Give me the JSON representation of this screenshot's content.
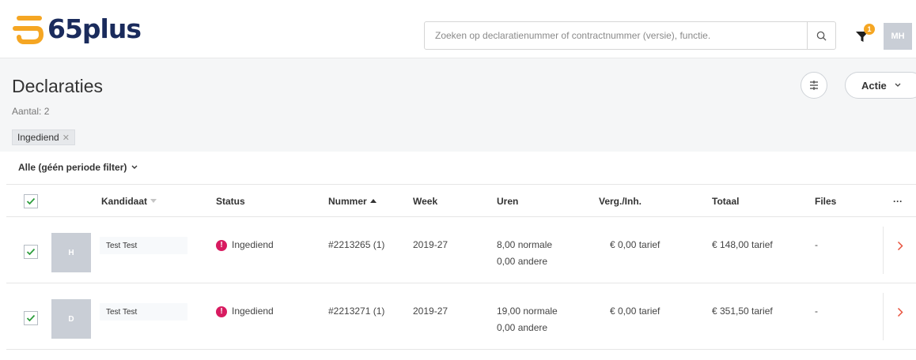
{
  "brand": {
    "name": "65plus",
    "accent": "#f5a623",
    "navy": "#1a2b5c"
  },
  "search": {
    "placeholder": "Zoeken op declaratienummer of contractnummer (versie), functie.",
    "icon": "search-icon"
  },
  "topbar": {
    "filter_badge": "1",
    "user_initials": "MH"
  },
  "page": {
    "title": "Declaraties",
    "count": "Aantal: 2",
    "chip": "Ingediend",
    "actie": "Actie",
    "period": "Alle (géén periode filter)"
  },
  "table": {
    "headers": {
      "kandidaat": "Kandidaat",
      "status": "Status",
      "nummer": "Nummer",
      "week": "Week",
      "uren": "Uren",
      "verg": "Verg./Inh.",
      "totaal": "Totaal",
      "files": "Files",
      "more": "···"
    },
    "rows": [
      {
        "initial": "H",
        "name": "Test Test",
        "status": "Ingediend",
        "nummer": "#2213265 (1)",
        "week": "2019-27",
        "uren_normaal": "8,00 normale",
        "uren_andere": "0,00 andere",
        "verg": "€ 0,00 tarief",
        "totaal": "€ 148,00 tarief",
        "files": "-"
      },
      {
        "initial": "D",
        "name": "Test Test",
        "status": "Ingediend",
        "nummer": "#2213271 (1)",
        "week": "2019-27",
        "uren_normaal": "19,00 normale",
        "uren_andere": "0,00 andere",
        "verg": "€ 0,00 tarief",
        "totaal": "€ 351,50 tarief",
        "files": "-"
      }
    ]
  }
}
